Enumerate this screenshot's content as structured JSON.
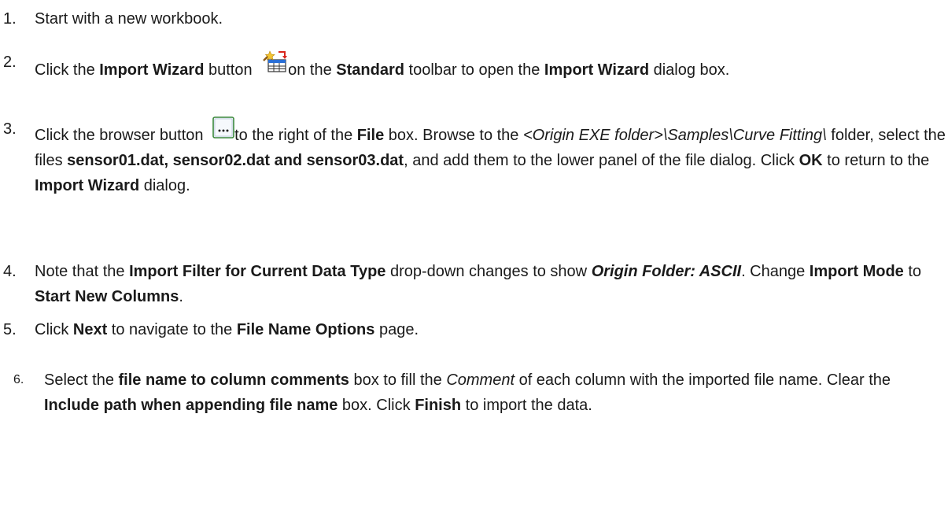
{
  "steps": [
    {
      "num": "1.",
      "parts": [
        {
          "t": "Start with a new workbook."
        }
      ]
    },
    {
      "num": "2.",
      "parts": [
        {
          "t": "Click the "
        },
        {
          "t": "Import Wizard",
          "b": true
        },
        {
          "t": " button "
        },
        {
          "icon": "import-wizard-icon"
        },
        {
          "t": "on the "
        },
        {
          "t": "Standard",
          "b": true
        },
        {
          "t": " toolbar to open the "
        },
        {
          "t": "Import Wizard",
          "b": true
        },
        {
          "t": " dialog box."
        }
      ]
    },
    {
      "num": "3.",
      "parts": [
        {
          "t": "Click the browser button "
        },
        {
          "icon": "browse-ellipsis-icon"
        },
        {
          "t": "to the right of the "
        },
        {
          "t": "File",
          "b": true
        },
        {
          "t": " box. Browse to the "
        },
        {
          "t": "<Origin EXE folder>\\Samples\\Curve Fitting\\",
          "i": true
        },
        {
          "t": " folder, select the files "
        },
        {
          "t": "sensor01.dat, sensor02.dat and sensor03.dat",
          "b": true
        },
        {
          "t": ", and add them to the lower panel of the file dialog. Click "
        },
        {
          "t": "OK",
          "b": true
        },
        {
          "t": " to return to the "
        },
        {
          "t": "Import Wizard",
          "b": true
        },
        {
          "t": " dialog."
        }
      ]
    },
    {
      "num": "4.",
      "parts": [
        {
          "t": "Note that the "
        },
        {
          "t": "Import Filter for Current Data Type",
          "b": true
        },
        {
          "t": " drop-down changes to show "
        },
        {
          "t": "Origin Folder: ASCII",
          "b": true,
          "i": true
        },
        {
          "t": ". Change "
        },
        {
          "t": "Import Mode",
          "b": true
        },
        {
          "t": " to "
        },
        {
          "t": "Start New Columns",
          "b": true
        },
        {
          "t": "."
        }
      ]
    },
    {
      "num": "5.",
      "parts": [
        {
          "t": "Click "
        },
        {
          "t": "Next",
          "b": true
        },
        {
          "t": " to navigate to the "
        },
        {
          "t": "File Name Options",
          "b": true
        },
        {
          "t": " page."
        }
      ]
    },
    {
      "num": "6.",
      "parts": [
        {
          "t": "Select the "
        },
        {
          "t": "file name to column comments",
          "b": true
        },
        {
          "t": " box to fill the "
        },
        {
          "t": "Comment",
          "i": true
        },
        {
          "t": " of each column with the imported file name. Clear the "
        },
        {
          "t": "Include path when appending file name",
          "b": true
        },
        {
          "t": " box. Click "
        },
        {
          "t": "Finish",
          "b": true
        },
        {
          "t": " to import the data."
        }
      ]
    }
  ]
}
